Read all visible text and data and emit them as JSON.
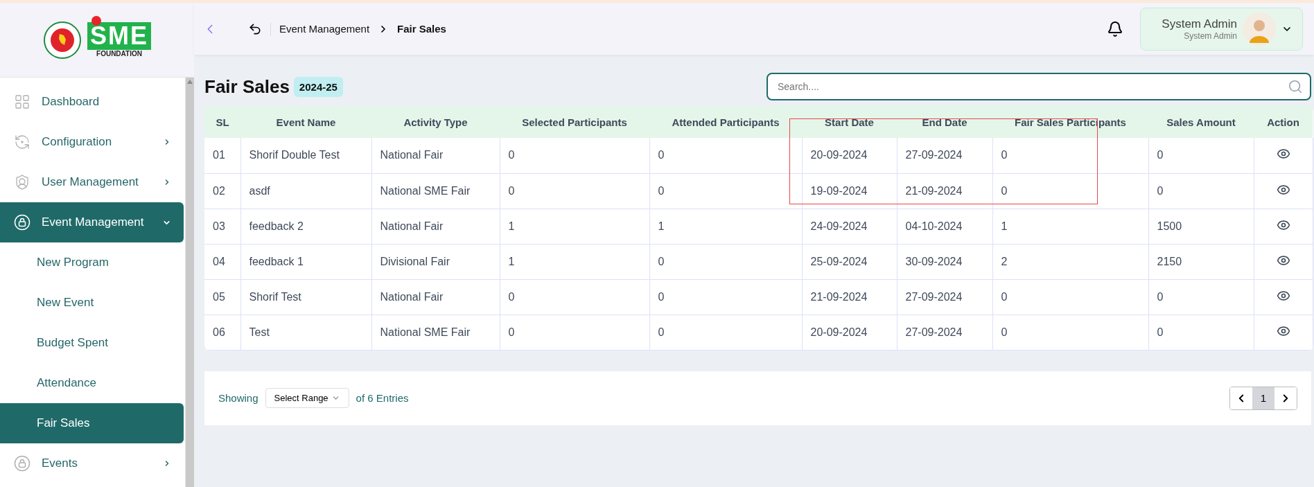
{
  "sidebar": {
    "items": [
      {
        "label": "Dashboard",
        "kind": "link",
        "selected": false
      },
      {
        "label": "Configuration",
        "kind": "group",
        "selected": false,
        "expanded": false
      },
      {
        "label": "User Management",
        "kind": "group",
        "selected": false,
        "expanded": false
      },
      {
        "label": "Event Management",
        "kind": "group",
        "selected": true,
        "expanded": true,
        "children": [
          {
            "label": "New Program",
            "selected": false
          },
          {
            "label": "New Event",
            "selected": false
          },
          {
            "label": "Budget Spent",
            "selected": false
          },
          {
            "label": "Attendance",
            "selected": false
          },
          {
            "label": "Fair Sales",
            "selected": true
          }
        ]
      },
      {
        "label": "Events",
        "kind": "group",
        "selected": false,
        "expanded": false
      }
    ]
  },
  "logo": {
    "text": "SME",
    "subtitle": "FOUNDATION"
  },
  "header": {
    "breadcrumb": [
      "Event Management",
      "Fair Sales"
    ],
    "user": {
      "name": "System Admin",
      "role": "System Admin"
    }
  },
  "page": {
    "title": "Fair Sales",
    "badge": "2024-25",
    "search": {
      "placeholder": "Search...."
    }
  },
  "table": {
    "columns": [
      "SL",
      "Event Name",
      "Activity Type",
      "Selected Participants",
      "Attended Participants",
      "Start Date",
      "End Date",
      "Fair Sales Participants",
      "Sales Amount",
      "Action"
    ],
    "rows": [
      [
        "01",
        "Shorif Double Test",
        "National Fair",
        "0",
        "0",
        "20-09-2024",
        "27-09-2024",
        "0",
        "0"
      ],
      [
        "02",
        "asdf",
        "National SME Fair",
        "0",
        "0",
        "19-09-2024",
        "21-09-2024",
        "0",
        "0"
      ],
      [
        "03",
        "feedback 2",
        "National Fair",
        "1",
        "1",
        "24-09-2024",
        "04-10-2024",
        "1",
        "1500"
      ],
      [
        "04",
        "feedback 1",
        "Divisional Fair",
        "1",
        "0",
        "25-09-2024",
        "30-09-2024",
        "2",
        "2150"
      ],
      [
        "05",
        "Shorif Test",
        "National Fair",
        "0",
        "0",
        "21-09-2024",
        "27-09-2024",
        "0",
        "0"
      ],
      [
        "06",
        "Test",
        "National SME Fair",
        "0",
        "0",
        "20-09-2024",
        "27-09-2024",
        "0",
        "0"
      ]
    ]
  },
  "footer": {
    "showing": "Showing",
    "range": "Select Range",
    "entries": "of 6 Entries",
    "pages": [
      {
        "label": "1",
        "selected": true
      }
    ]
  }
}
